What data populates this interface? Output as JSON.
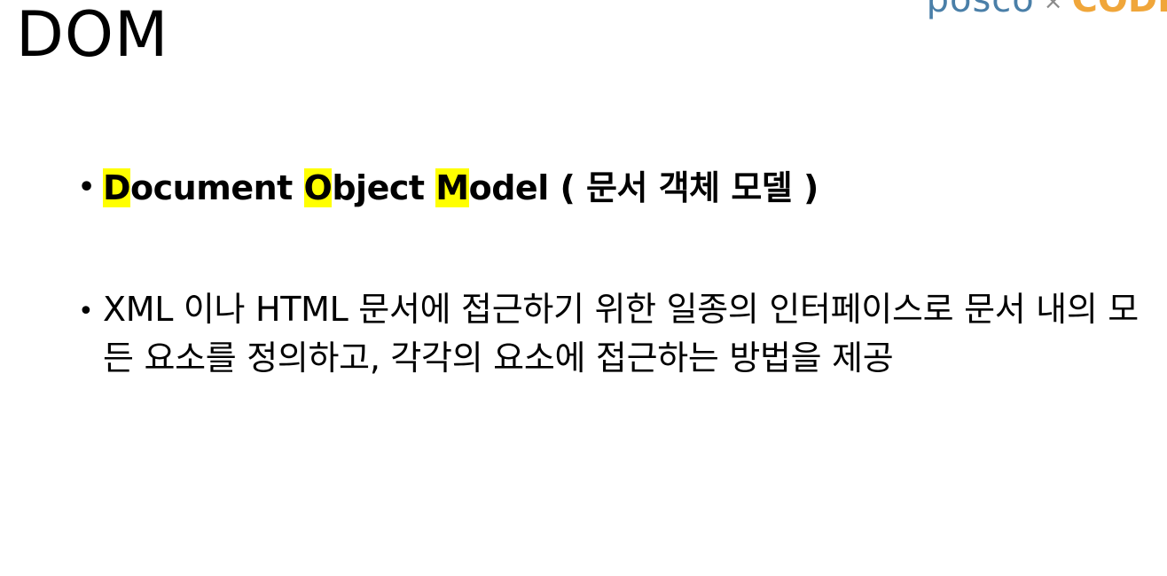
{
  "slide": {
    "title": "DOM",
    "logo": {
      "left_text": "posco",
      "separator": "×",
      "right_text": "CODI"
    },
    "bullets": [
      {
        "marker": "•",
        "parts": {
          "d": "D",
          "ocument": "ocument ",
          "o": "O",
          "bject": "bject ",
          "m": "M",
          "odel": "odel ( 문서 객체 모델 )"
        }
      },
      {
        "marker": "•",
        "text": "XML 이나 HTML 문서에 접근하기 위한 일종의 인터페이스로 문서 내의 모든 요소를 정의하고, 각각의 요소에 접근하는 방법을 제공"
      }
    ]
  },
  "colors": {
    "highlight": "#ffff00",
    "logo_blue": "#4a7fa8",
    "logo_orange": "#f0a63a"
  }
}
